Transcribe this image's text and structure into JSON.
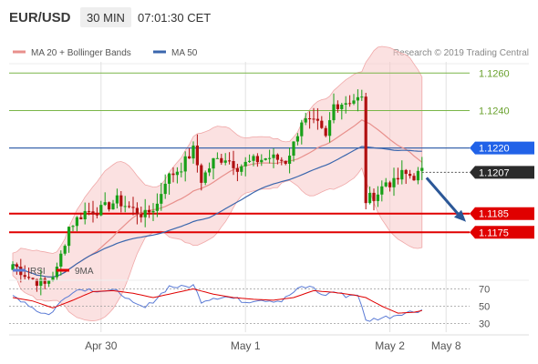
{
  "header": {
    "symbol": "EUR/USD",
    "timeframe": "30 MIN",
    "time": "07:01:30 CET"
  },
  "legend": {
    "ma20_label": "MA 20 + Bollinger Bands",
    "ma50_label": "MA 50",
    "copyright": "Research © 2019 Trading Central",
    "rsi_label": "RSI",
    "ma9_label": "9MA"
  },
  "colors": {
    "candle_up": "#18a018",
    "candle_down": "#b01010",
    "ma20": "#e8908c",
    "bollinger_fill": "#f8c8c8",
    "ma50": "#3a66ad",
    "support_resistance": "#e00000",
    "target_level": "#7ab648",
    "current_price_bg": "#2b2b2b",
    "ma50_price_bg": "#2162e8",
    "rsi_line": "#5b7bd5",
    "rsi_ma_line": "#e00000",
    "arrow": "#2b5797",
    "grid": "#e0e0e0"
  },
  "chart_data": {
    "type": "candlestick",
    "symbol": "EUR/USD",
    "timeframe": "30 MIN",
    "price_axis": {
      "ylim": [
        1.1163,
        1.1265
      ],
      "labels": [
        {
          "value": 1.126,
          "text": "1.1260",
          "role": "resistance target"
        },
        {
          "value": 1.124,
          "text": "1.1240",
          "role": "resistance target"
        },
        {
          "value": 1.122,
          "text": "1.1220",
          "role": "MA 50"
        },
        {
          "value": 1.1207,
          "text": "1.1207",
          "role": "current price"
        },
        {
          "value": 1.1185,
          "text": "1.1185",
          "role": "support"
        },
        {
          "value": 1.1175,
          "text": "1.1175",
          "role": "support"
        }
      ]
    },
    "x_axis": {
      "labels": [
        {
          "index": 22,
          "text": "Apr 30"
        },
        {
          "index": 58,
          "text": "May 1"
        },
        {
          "index": 94,
          "text": "May 2"
        },
        {
          "index": 108,
          "text": "May 8"
        }
      ]
    },
    "price_key_points": [
      [
        0,
        1.1158
      ],
      [
        4,
        1.1151
      ],
      [
        8,
        1.1147
      ],
      [
        11,
        1.1155
      ],
      [
        14,
        1.1178
      ],
      [
        18,
        1.1186
      ],
      [
        22,
        1.1187
      ],
      [
        26,
        1.1192
      ],
      [
        30,
        1.1187
      ],
      [
        33,
        1.1184
      ],
      [
        36,
        1.119
      ],
      [
        38,
        1.1203
      ],
      [
        42,
        1.121
      ],
      [
        45,
        1.1219
      ],
      [
        47,
        1.1203
      ],
      [
        50,
        1.1213
      ],
      [
        53,
        1.1215
      ],
      [
        56,
        1.121
      ],
      [
        60,
        1.1213
      ],
      [
        64,
        1.1215
      ],
      [
        68,
        1.1213
      ],
      [
        70,
        1.1222
      ],
      [
        72,
        1.1235
      ],
      [
        76,
        1.1232
      ],
      [
        78,
        1.1225
      ],
      [
        80,
        1.1243
      ],
      [
        85,
        1.1246
      ],
      [
        87,
        1.1246
      ],
      [
        88,
        1.1192
      ],
      [
        91,
        1.1196
      ],
      [
        93,
        1.1202
      ],
      [
        95,
        1.1201
      ],
      [
        97,
        1.1206
      ],
      [
        100,
        1.1205
      ],
      [
        102,
        1.1207
      ]
    ],
    "rsi": {
      "ylim": [
        20,
        80
      ],
      "ticks": [
        70,
        50,
        30
      ],
      "rsi_key_points": [
        [
          0,
          62
        ],
        [
          3,
          55
        ],
        [
          6,
          45
        ],
        [
          9,
          40
        ],
        [
          12,
          55
        ],
        [
          15,
          68
        ],
        [
          18,
          70
        ],
        [
          22,
          68
        ],
        [
          26,
          67
        ],
        [
          28,
          62
        ],
        [
          30,
          52
        ],
        [
          33,
          48
        ],
        [
          36,
          60
        ],
        [
          39,
          73
        ],
        [
          42,
          72
        ],
        [
          45,
          74
        ],
        [
          47,
          56
        ],
        [
          50,
          60
        ],
        [
          53,
          61
        ],
        [
          56,
          58
        ],
        [
          58,
          55
        ],
        [
          61,
          58
        ],
        [
          64,
          57
        ],
        [
          67,
          56
        ],
        [
          69,
          63
        ],
        [
          72,
          72
        ],
        [
          75,
          72
        ],
        [
          77,
          62
        ],
        [
          80,
          67
        ],
        [
          83,
          62
        ],
        [
          86,
          64
        ],
        [
          88,
          33
        ],
        [
          91,
          36
        ],
        [
          94,
          38
        ],
        [
          97,
          42
        ],
        [
          100,
          44
        ],
        [
          102,
          46
        ]
      ],
      "ma9_key_points": [
        [
          0,
          60
        ],
        [
          5,
          56
        ],
        [
          10,
          48
        ],
        [
          15,
          57
        ],
        [
          20,
          67
        ],
        [
          25,
          68
        ],
        [
          30,
          65
        ],
        [
          35,
          60
        ],
        [
          40,
          65
        ],
        [
          45,
          70
        ],
        [
          50,
          64
        ],
        [
          55,
          60
        ],
        [
          60,
          58
        ],
        [
          65,
          57
        ],
        [
          70,
          60
        ],
        [
          75,
          68
        ],
        [
          80,
          66
        ],
        [
          85,
          63
        ],
        [
          88,
          60
        ],
        [
          92,
          50
        ],
        [
          96,
          42
        ],
        [
          100,
          43
        ],
        [
          102,
          45
        ]
      ]
    },
    "projection": {
      "from_price": 1.1207,
      "to_price": 1.1185,
      "direction": "down"
    }
  }
}
